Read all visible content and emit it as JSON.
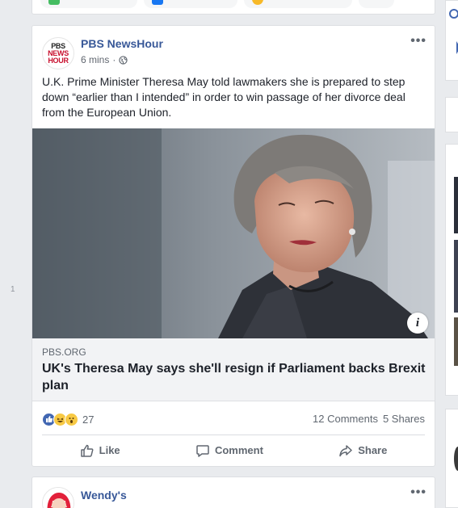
{
  "composer": {
    "pills": [
      {
        "icon": "photo-icon",
        "color": "#45bd62"
      },
      {
        "icon": "tag-friends-icon",
        "color": "#1877f2"
      },
      {
        "icon": "feeling-icon",
        "color": "#f7b928"
      }
    ]
  },
  "side_marker": "1",
  "post": {
    "page_logo_line1": "PBS",
    "page_logo_line2": "NEWS",
    "page_logo_line3": "HOUR",
    "author": "PBS NewsHour",
    "time": "6 mins",
    "separator": "·",
    "privacy_icon": "globe-icon",
    "more_label": "•••",
    "text": "U.K. Prime Minister Theresa May told lawmakers she is prepared to step down “earlier than I intended” in order to win passage of her divorce deal from the European Union.",
    "image_info_label": "i",
    "link": {
      "domain": "PBS.ORG",
      "headline": "UK's Theresa May says she'll resign if Parliament backs Brexit plan"
    },
    "reactions": {
      "types": [
        "like",
        "haha",
        "wow"
      ],
      "count": "27"
    },
    "comments": "12 Comments",
    "shares": "5 Shares",
    "actions": {
      "like": "Like",
      "comment": "Comment",
      "share": "Share"
    }
  },
  "next_post": {
    "author": "Wendy's",
    "more_label": "•••"
  },
  "colors": {
    "link_blue": "#385898",
    "like_blue": "#4267b2",
    "background": "#e9ebee"
  }
}
